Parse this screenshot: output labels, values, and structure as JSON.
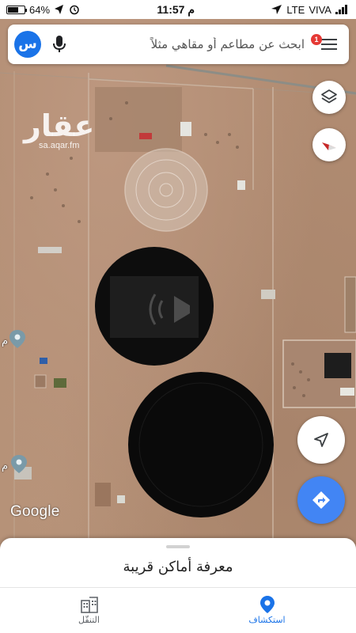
{
  "status_bar": {
    "battery": "64%",
    "battery_level": 0.64,
    "time": "11:57 م",
    "network": "LTE",
    "carrier": "VIVA"
  },
  "search": {
    "placeholder": "ابحث عن مطاعم أو مقاهي مثلاً",
    "avatar_letter": "س",
    "notification_count": "1"
  },
  "watermark": {
    "logo": "عقار",
    "url": "sa.aqar.fm"
  },
  "map": {
    "google_logo": "Google",
    "left_label_1": "م",
    "left_label_2": "م"
  },
  "sheet": {
    "title": "معرفة أماكن قريبة"
  },
  "nav": {
    "items": [
      {
        "label": "التنقّل",
        "icon": "commute-icon",
        "active": false
      },
      {
        "label": "استكشاف",
        "icon": "explore-pin-icon",
        "active": true
      }
    ]
  },
  "colors": {
    "accent": "#1a73e8",
    "directions": "#4285f4",
    "badge": "#e53935",
    "compass_red": "#e53935"
  }
}
